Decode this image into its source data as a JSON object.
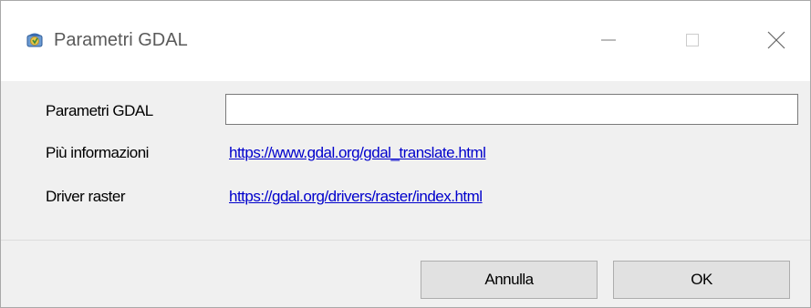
{
  "window": {
    "title": "Parametri GDAL",
    "app_icon": "qgis-app-icon",
    "controls": {
      "minimize_icon": "minimize-icon",
      "maximize_icon": "maximize-icon",
      "close_icon": "close-icon"
    }
  },
  "form": {
    "params_label": "Parametri GDAL",
    "params_value": "",
    "info_label": "Più informazioni",
    "info_link": "https://www.gdal.org/gdal_translate.html",
    "driver_label": "Driver raster",
    "driver_link": "https://gdal.org/drivers/raster/index.html"
  },
  "buttons": {
    "cancel_label": "Annulla",
    "ok_label": "OK"
  },
  "colors": {
    "link": "#0000cc",
    "dialog_background": "#f0f0f0",
    "button_face": "#e1e1e1"
  }
}
